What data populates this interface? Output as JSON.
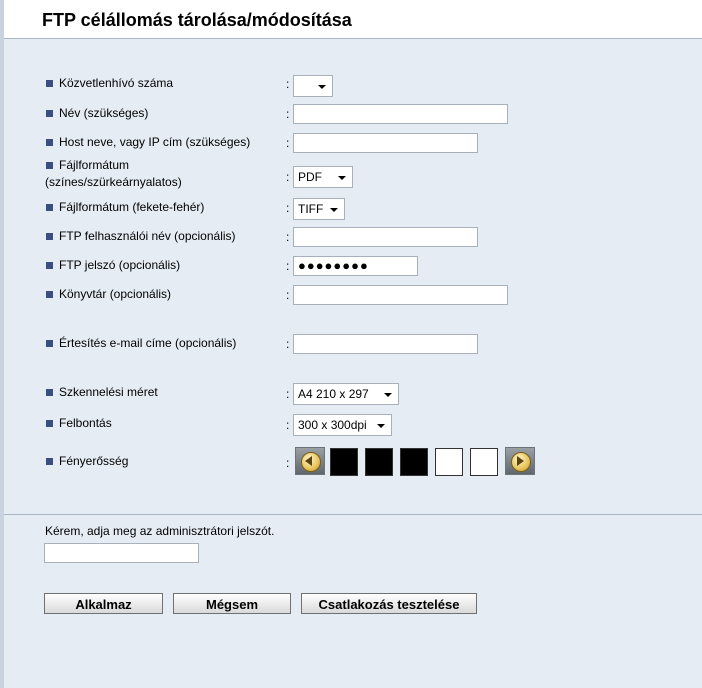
{
  "page": {
    "title": "FTP célállomás tárolása/módosítása"
  },
  "fields": {
    "intermediary": {
      "label": "Közvetlenhívó száma",
      "value": ""
    },
    "name": {
      "label": "Név (szükséges)",
      "value": ""
    },
    "host": {
      "label": "Host neve, vagy IP cím (szükséges)",
      "value": ""
    },
    "file_format_color": {
      "label_line1": "Fájlformátum",
      "label_line2": "(színes/szürkeárnyalatos)",
      "value": "PDF"
    },
    "file_format_bw": {
      "label": "Fájlformátum (fekete-fehér)",
      "value": "TIFF"
    },
    "ftp_user": {
      "label": "FTP felhasználói név (opcionális)",
      "value": ""
    },
    "ftp_password": {
      "label": "FTP jelszó (opcionális)",
      "value": "●●●●●●●●"
    },
    "directory": {
      "label": "Könyvtár (opcionális)",
      "value": ""
    },
    "notify_email": {
      "label": "Értesítés e-mail címe (opcionális)",
      "value": ""
    },
    "scan_size": {
      "label": "Szkennelési méret",
      "value": "A4 210 x 297"
    },
    "resolution": {
      "label": "Felbontás",
      "value": "300 x 300dpi"
    },
    "brightness": {
      "label": "Fényerősség",
      "levels_total": 5,
      "level": 3
    }
  },
  "colon": ":",
  "admin": {
    "prompt": "Kérem, adja meg az adminisztrátori jelszót.",
    "value": ""
  },
  "buttons": {
    "apply": "Alkalmaz",
    "cancel": "Mégsem",
    "test": "Csatlakozás tesztelése"
  },
  "colors": {
    "accent": "#3a4f80",
    "background": "#e6ecf4"
  }
}
